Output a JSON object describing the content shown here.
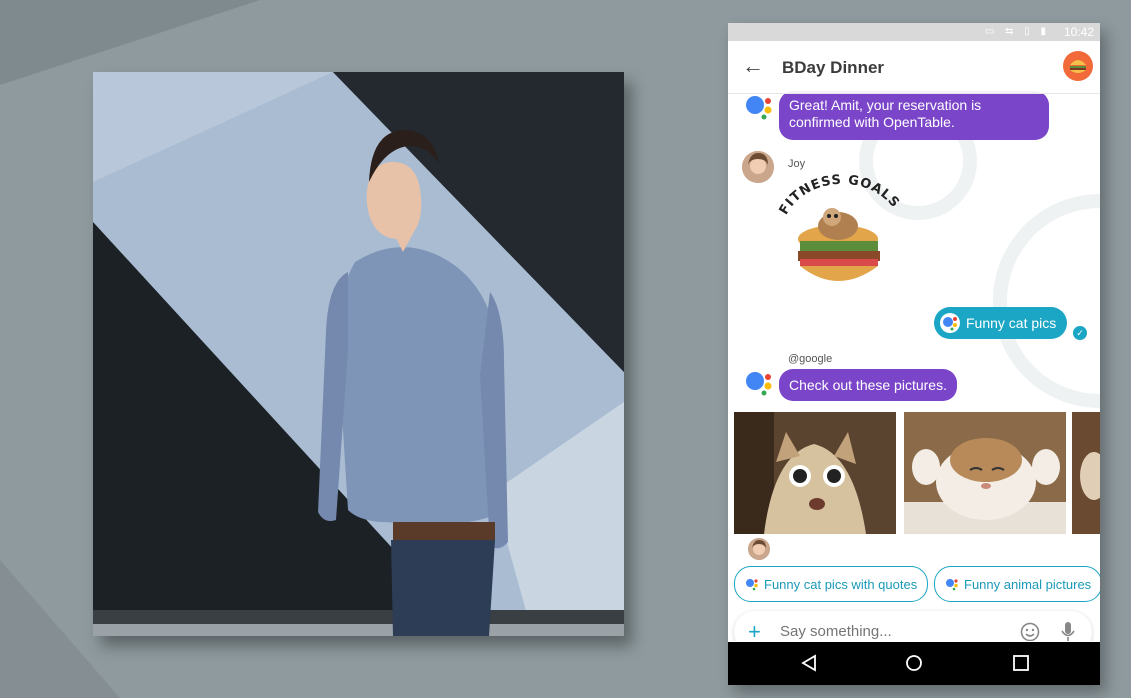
{
  "phone": {
    "status": {
      "time": "10:42"
    },
    "app_bar": {
      "title": "BDay Dinner"
    },
    "messages": {
      "top_bubble_text": "Great! Amit, your reservation is confirmed with OpenTable.",
      "sender_joy": "Joy",
      "sticker_text": "FITNESS GOALS",
      "user_message": "Funny cat pics",
      "assistant_handle": "@google",
      "assistant_reply": "Check out these pictures."
    },
    "suggestion_chips": [
      {
        "label": "Funny cat pics with quotes"
      },
      {
        "label": "Funny animal pictures"
      }
    ],
    "composer": {
      "placeholder": "Say something..."
    },
    "colors": {
      "assistant_purple": "#7a45c9",
      "user_teal": "#1aa6c4",
      "background_slate": "#8e9a9e"
    },
    "icons": [
      "back-arrow-icon",
      "group-avatar-icon",
      "google-assistant-icon",
      "check-icon",
      "plus-icon",
      "emoji-icon",
      "mic-icon",
      "nav-back-icon",
      "nav-home-icon",
      "nav-recents-icon"
    ]
  }
}
